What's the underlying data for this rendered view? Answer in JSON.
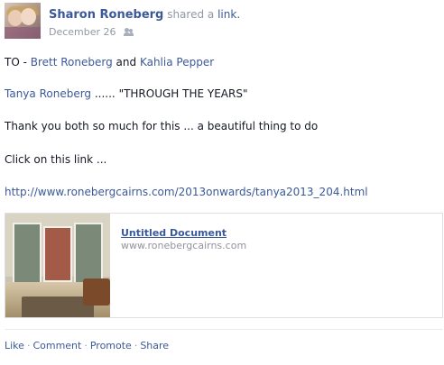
{
  "post": {
    "author": "Sharon Roneberg",
    "action": "shared a",
    "action_link": "link.",
    "date": "December 26",
    "audience_icon": "friends-icon"
  },
  "message": {
    "line1": {
      "prefix": "TO - ",
      "name1": "Brett Roneberg",
      "conj": " and ",
      "name2": "Kahlia Pepper"
    },
    "line2": {
      "name": "Tanya Roneberg",
      "text": " ...... \"THROUGH THE YEARS\""
    },
    "line3": "Thank you both so much for this ... a beautiful thing to do",
    "line4": "Click on this link ...",
    "line5_url": "http://www.ronebergcairns.com/2013onwards/tanya2013_204.html"
  },
  "shared_link": {
    "title": "Untitled Document",
    "domain": "www.ronebergcairns.com"
  },
  "actions": {
    "like": "Like",
    "comment": "Comment",
    "promote": "Promote",
    "share": "Share",
    "separator": "·"
  }
}
